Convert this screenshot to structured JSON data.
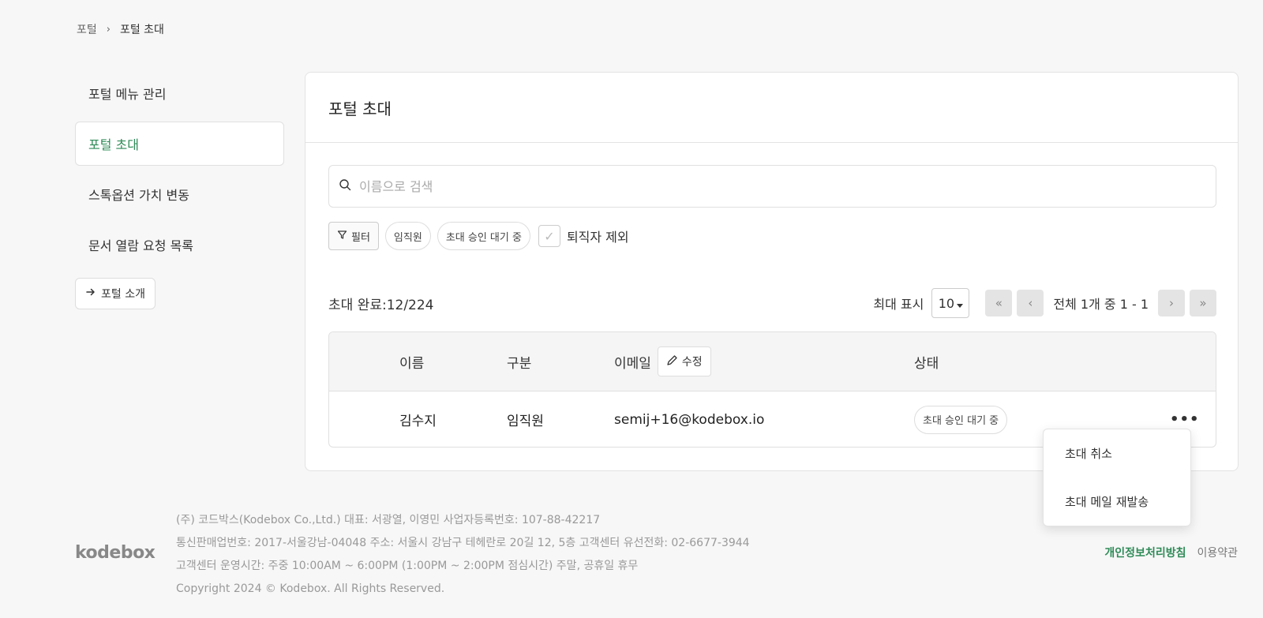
{
  "breadcrumb": {
    "root": "포털",
    "separator": "›",
    "current": "포털 초대"
  },
  "sidebar": {
    "items": [
      {
        "label": "포털 메뉴 관리",
        "active": false
      },
      {
        "label": "포털 초대",
        "active": true
      },
      {
        "label": "스톡옵션 가치 변동",
        "active": false
      },
      {
        "label": "문서 열람 요청 목록",
        "active": false
      }
    ],
    "intro_button": "포털 소개",
    "intro_icon": "arrow-right-icon"
  },
  "card": {
    "title": "포털 초대"
  },
  "search": {
    "placeholder": "이름으로 검색",
    "value": ""
  },
  "filters": {
    "filter_label": "필터",
    "chips": [
      "임직원",
      "초대 승인 대기 중"
    ],
    "exclude_retired_label": "퇴직자 제외",
    "exclude_retired_checked": false
  },
  "summary": {
    "completed_text": "초대 완료:12/224"
  },
  "pagination": {
    "max_label": "최대 표시",
    "page_size": "10",
    "range_text": "전체 1개 중 1 - 1",
    "first": "«",
    "prev": "‹",
    "next": "›",
    "last": "»"
  },
  "table": {
    "headers": {
      "name": "이름",
      "type": "구분",
      "email": "이메일",
      "status": "상태"
    },
    "edit_label": "수정",
    "rows": [
      {
        "name": "김수지",
        "type": "임직원",
        "email": "semij+16@kodebox.io",
        "status": "초대 승인 대기 중"
      }
    ]
  },
  "row_menu": {
    "items": [
      "초대 취소",
      "초대 메일 재발송"
    ]
  },
  "footer": {
    "logo": "kodebox",
    "lines": [
      "(주) 코드박스(Kodebox Co.,Ltd.) 대표: 서광열, 이영민 사업자등록번호: 107-88-42217",
      "통신판매업번호: 2017-서울강남-04048 주소: 서울시 강남구 테헤란로 20길 12, 5층 고객센터 유선전화: 02-6677-3944",
      "고객센터 운영시간: 주중 10:00AM ~ 6:00PM (1:00PM ~ 2:00PM 점심시간) 주말, 공휴일 휴무",
      "Copyright 2024 © Kodebox. All Rights Reserved."
    ],
    "privacy_link": "개인정보처리방침",
    "terms_link": "이용약관"
  },
  "colors": {
    "accent": "#2e8b57",
    "background": "#f7f7f7"
  }
}
